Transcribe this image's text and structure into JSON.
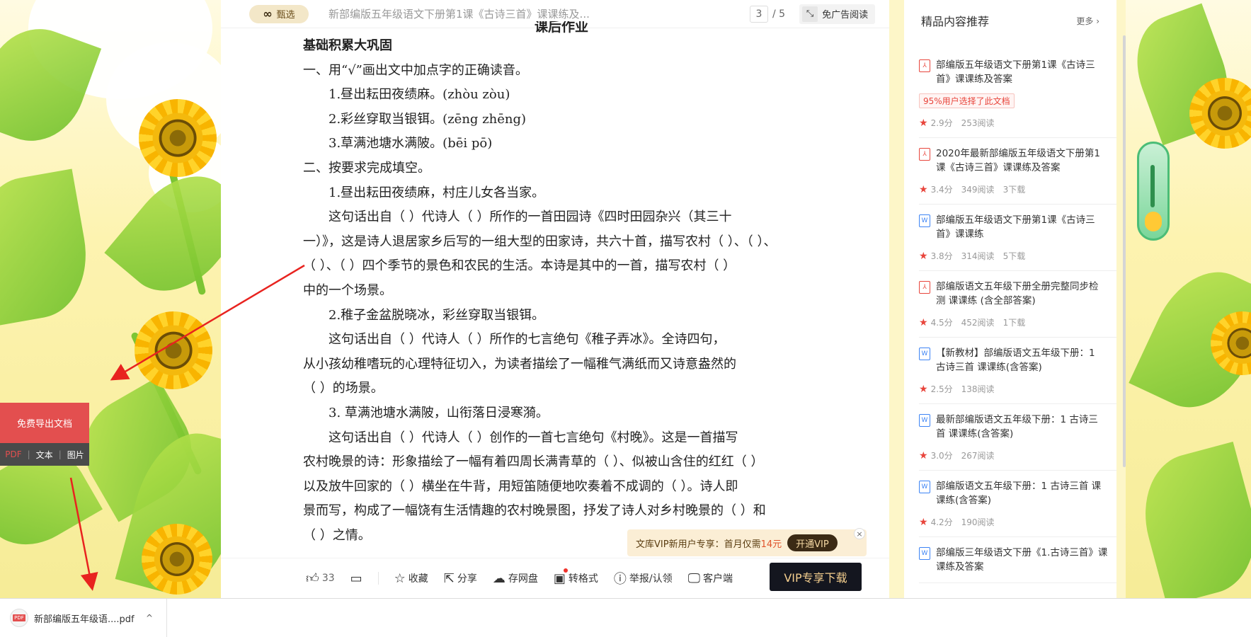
{
  "toolbar": {
    "zhenxuan_label": "甄选",
    "doc_title": "新部编版五年级语文下册第1课《古诗三首》课课练及...",
    "page_current": "3",
    "page_total": "/ 5",
    "no_ad_label": "免广告阅读"
  },
  "document": {
    "heading": "课后作业",
    "lines": [
      {
        "style": "bold",
        "text": "基础积累大巩固"
      },
      {
        "style": "",
        "text": "一、用“√”画出文中加点字的正确读音。"
      },
      {
        "style": "i1",
        "text": "1.昼出耘田夜绩麻。(zhòu  zòu)"
      },
      {
        "style": "i1",
        "text": "2.彩丝穿取当银铒。(zēng  zhēng)"
      },
      {
        "style": "i1",
        "text": "3.草满池塘水满陂。(bēi  pō)"
      },
      {
        "style": "",
        "text": "二、按要求完成填空。"
      },
      {
        "style": "i1",
        "text": "1.昼出耘田夜绩麻，村庄儿女各当家。"
      },
      {
        "style": "i1",
        "text": "这句话出自（       ）代诗人（          ）所作的一首田园诗《四时田园杂兴（其三十"
      },
      {
        "style": "",
        "text": "一）》，这是诗人退居家乡后写的一组大型的田家诗，共六十首，描写农村（   ）、（   ）、"
      },
      {
        "style": "",
        "text": "（    ）、（   ）四个季节的景色和农民的生活。本诗是其中的一首，描写农村（                ）"
      },
      {
        "style": "",
        "text": "中的一个场景。"
      },
      {
        "style": "i1",
        "text": "2.稚子金盆脱晓冰，彩丝穿取当银铒。"
      },
      {
        "style": "i1",
        "text": "这句话出自（       ）代诗人（          ）所作的七言绝句《稚子弄冰》。全诗四句，"
      },
      {
        "style": "",
        "text": "从小孩幼稚嗜玩的心理特征切入，为读者描绘了一幅稚气满纸而又诗意盎然的"
      },
      {
        "style": "",
        "text": "（                 ）的场景。"
      },
      {
        "style": "i1",
        "text": "3. 草满池塘水满陂，山衔落日浸寒漪。"
      },
      {
        "style": "i1",
        "text": "这句话出自（       ）代诗人（       ）创作的一首七言绝句《村晚》。这是一首描写"
      },
      {
        "style": "",
        "text": "农村晚景的诗：形象描绘了一幅有着四周长满青草的（       ）、似被山含住的红红（       ）"
      },
      {
        "style": "",
        "text": "以及放牛回家的（       ）横坐在牛背，用短笛随便地吹奏着不成调的（       ）。诗人即"
      },
      {
        "style": "",
        "text": "景而写，构成了一幅饶有生活情趣的农村晚景图，抒发了诗人对乡村晚景的（       ）和"
      },
      {
        "style": "",
        "text": "（       ）之情。"
      }
    ]
  },
  "vip_popup": {
    "text_before": "文库VIP新用户专享：首月仅需",
    "price": "14元",
    "open_label": "开通VIP",
    "close_symbol": "×"
  },
  "bottom_bar": {
    "like_count": "33",
    "favorite_label": "收藏",
    "share_label": "分享",
    "save_cloud_label": "存网盘",
    "convert_label": "转格式",
    "report_label": "举报/认领",
    "client_label": "客户端",
    "vip_download_label": "VIP专享下载"
  },
  "recommendations": {
    "title": "精品内容推荐",
    "more_label": "更多 ›",
    "items": [
      {
        "file_type": "pdf",
        "title": "部编版五年级语文下册第1课《古诗三\n首》课课练及答案",
        "badge": "95%用户选择了此文档",
        "score": "2.9分",
        "reads": "253阅读",
        "downloads": ""
      },
      {
        "file_type": "pdf",
        "title": "2020年最新部编版五年级语文下册第1\n课《古诗三首》课课练及答案",
        "badge": "",
        "score": "3.4分",
        "reads": "349阅读",
        "downloads": "3下载"
      },
      {
        "file_type": "word",
        "title": "部编版五年级语文下册第1课《古诗三\n首》课课练",
        "badge": "",
        "score": "3.8分",
        "reads": "314阅读",
        "downloads": "5下载"
      },
      {
        "file_type": "pdf",
        "title": "部编版语文五年级下册全册完整同步检\n测 课课练 (含全部答案)",
        "badge": "",
        "score": "4.5分",
        "reads": "452阅读",
        "downloads": "1下载"
      },
      {
        "file_type": "word",
        "title": "【新教材】部编版语文五年级下册：1\n古诗三首 课课练(含答案)",
        "badge": "",
        "score": "2.5分",
        "reads": "138阅读",
        "downloads": ""
      },
      {
        "file_type": "word",
        "title": "最新部编版语文五年级下册：1 古诗三\n首 课课练(含答案)",
        "badge": "",
        "score": "3.0分",
        "reads": "267阅读",
        "downloads": ""
      },
      {
        "file_type": "word",
        "title": "部编版语文五年级下册：1 古诗三首 课\n课练(含答案)",
        "badge": "",
        "score": "4.2分",
        "reads": "190阅读",
        "downloads": ""
      },
      {
        "file_type": "word",
        "title": "部编版三年级语文下册《1.古诗三首》课\n课练及答案",
        "badge": "",
        "score": "",
        "reads": "",
        "downloads": ""
      }
    ]
  },
  "export_panel": {
    "main_label": "免费导出文档",
    "pdf_label": "PDF",
    "text_label": "文本",
    "image_label": "图片",
    "separator": "|"
  },
  "download_shelf": {
    "file_name": "新部编版五年级语....pdf",
    "pdf_icon_text": "PDF",
    "chevron": "^"
  },
  "colors": {
    "accent_red": "#e34f4f",
    "vip_dark": "#14161f",
    "vip_gold": "#f5cf8e",
    "annotation_arrow": "#e8231f"
  }
}
